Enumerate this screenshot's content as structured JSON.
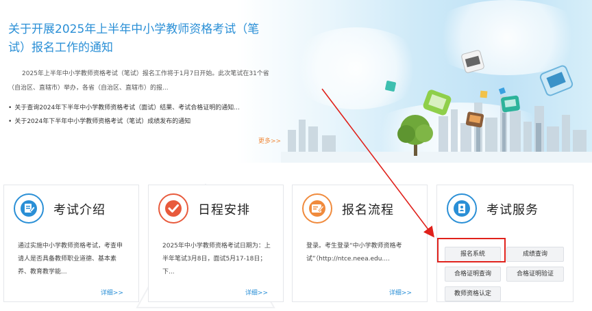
{
  "news": {
    "title": "关于开展2025年上半年中小学教师资格考试（笔试）报名工作的通知",
    "summary": "2025年上半年中小学教师资格考试（笔试）报名工作将于1月7日开始。此次笔试在31个省（自治区、直辖市）举办，各省（自治区、直辖市）的报...",
    "links": [
      "关于查询2024年下半年中小学教师资格考试（面试）结果、考试合格证明的通知...",
      "关于2024年下半年中小学教师资格考试（笔试）成绩发布的通知"
    ],
    "more_label": "更多>>"
  },
  "cards": [
    {
      "title": "考试介绍",
      "icon": "document-edit-icon",
      "description": "通过实施中小学教师资格考试，考查申请人是否具备教师职业道德、基本素养、教育教学能...",
      "detail_label": "详细>>"
    },
    {
      "title": "日程安排",
      "icon": "checkmark-icon",
      "description": "2025年中小学教师资格考试日期为：上半年笔试3月8日，面试5月17-18日；下...",
      "detail_label": "详细>>"
    },
    {
      "title": "报名流程",
      "icon": "registration-form-icon",
      "description": "登录。考生登录“中小学教师资格考试”（http://ntce.neea.edu....",
      "detail_label": "详细>>"
    },
    {
      "title": "考试服务",
      "icon": "service-contact-icon",
      "buttons": [
        "报名系统",
        "成绩查询",
        "合格证明查询",
        "合格证明验证",
        "教师资格认定"
      ]
    }
  ],
  "colors": {
    "accent_blue": "#2a8fd6",
    "more_orange": "#f08a3c",
    "highlight_red": "#e0211b",
    "icon_blue": "#2a8fd6",
    "icon_red": "#e85a3c",
    "icon_orange": "#f08a3c"
  }
}
